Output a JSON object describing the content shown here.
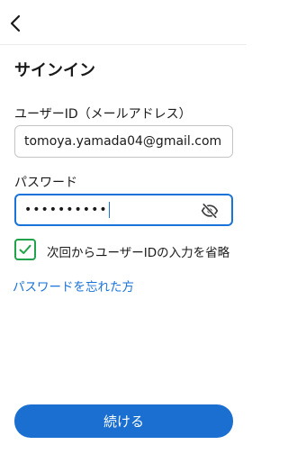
{
  "header": {
    "back_icon": "chevron-left-icon"
  },
  "page": {
    "title": "サインイン"
  },
  "email": {
    "label": "ユーザーID（メールアドレス）",
    "value": "tomoya.yamada04@gmail.com"
  },
  "password": {
    "label": "パスワード",
    "masked_value": "••••••••••",
    "visibility_icon": "eye-off-icon"
  },
  "remember": {
    "checked": true,
    "label": "次回からユーザーIDの入力を省略"
  },
  "links": {
    "forgot_password": "パスワードを忘れた方"
  },
  "actions": {
    "continue_label": "続ける"
  },
  "colors": {
    "accent": "#1a73d9",
    "check": "#22a24a",
    "button": "#1a6fd1"
  }
}
